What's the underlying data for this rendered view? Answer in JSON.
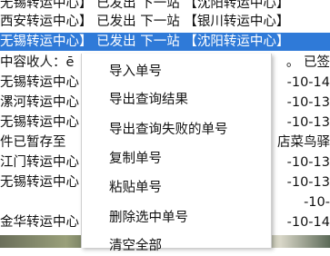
{
  "list_rows": [
    {
      "left": "无锡转运中心】 已发出 下一站 【沈阳转运中心】",
      "right": "",
      "selected": false
    },
    {
      "left": "西安转运中心】 已发出 下一站 【银川转运中心】",
      "right": "",
      "selected": false
    },
    {
      "left": "无锡转运中心】 已发出 下一站 【沈阳转运中心】",
      "right": "",
      "selected": true
    },
    {
      "left": "中容收人：ē",
      "right": "。 已签",
      "selected": false
    },
    {
      "left": "无锡转运中心",
      "right": "-10-14",
      "selected": false
    },
    {
      "left": "漯河转运中心",
      "right": "-10-13",
      "selected": false
    },
    {
      "left": "无锡转运中心",
      "right": "-10-13",
      "selected": false
    },
    {
      "left": "件已暂存至",
      "right": "店菜鸟驿",
      "selected": false
    },
    {
      "left": "江门转运中心",
      "right": "-10-13",
      "selected": false
    },
    {
      "left": "无锡转运中心",
      "right": "-10-13",
      "selected": false
    },
    {
      "left": "",
      "right": "-10-",
      "selected": false
    },
    {
      "left": "金华转运中心",
      "right": "-10-14",
      "selected": false
    }
  ],
  "context_menu": {
    "items": [
      {
        "label": "导入单号"
      },
      {
        "label": "导出查询结果"
      },
      {
        "label": "导出查询失败的单号"
      },
      {
        "label": "复制单号"
      },
      {
        "label": "粘贴单号"
      },
      {
        "label": "删除选中单号"
      },
      {
        "label": "清空全部"
      }
    ]
  }
}
